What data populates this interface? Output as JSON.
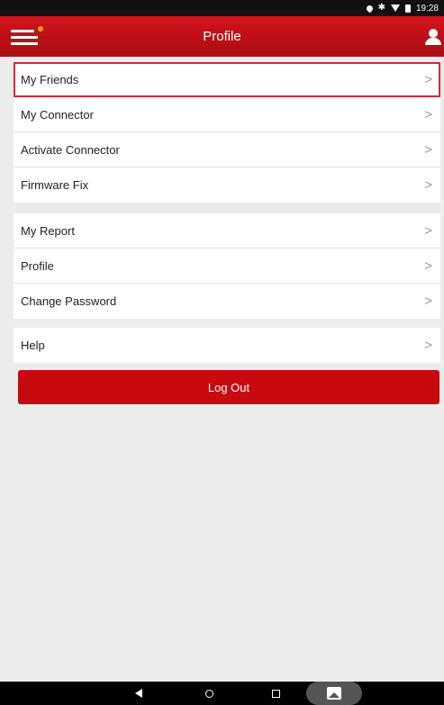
{
  "status_bar": {
    "time": "19:28"
  },
  "app_bar": {
    "title": "Profile"
  },
  "groups": [
    {
      "items": [
        {
          "label": "My Friends"
        },
        {
          "label": "My Connector"
        },
        {
          "label": "Activate Connector"
        },
        {
          "label": "Firmware Fix"
        }
      ]
    },
    {
      "items": [
        {
          "label": "My Report"
        },
        {
          "label": "Profile"
        },
        {
          "label": "Change Password"
        }
      ]
    },
    {
      "items": [
        {
          "label": "Help"
        }
      ]
    }
  ],
  "chevron": ">",
  "logout": {
    "label": "Log Out"
  },
  "colors": {
    "accent": "#c70a10",
    "highlight_border": "#d12a35",
    "badge": "#ff9a1a"
  }
}
